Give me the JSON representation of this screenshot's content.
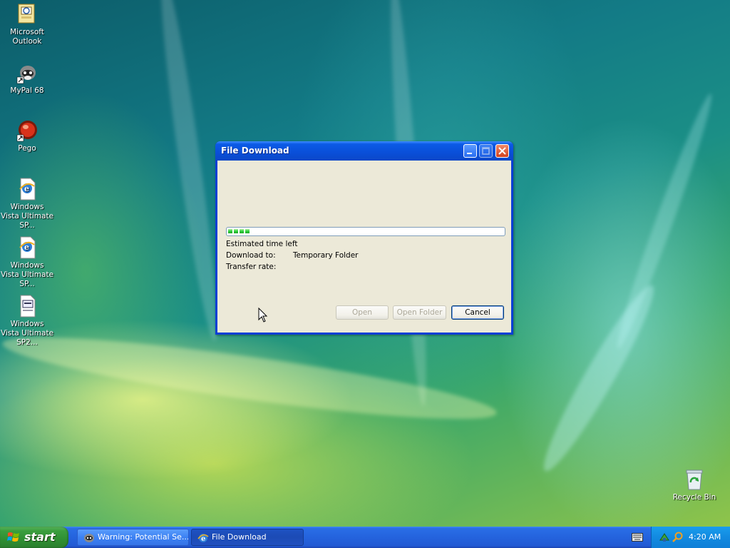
{
  "desktop": {
    "icons": [
      {
        "label": "Microsoft Outlook"
      },
      {
        "label": "MyPal 68"
      },
      {
        "label": "Pego"
      },
      {
        "label": "Windows Vista Ultimate SP..."
      },
      {
        "label": "Windows Vista Ultimate SP..."
      },
      {
        "label": "Windows Vista Ultimate SP2..."
      },
      {
        "label": "Recycle Bin"
      }
    ]
  },
  "dialog": {
    "title": "File Download",
    "progress_percent": 9,
    "estimated_time_label": "Estimated time left",
    "download_to_label": "Download to:",
    "download_to_value": "Temporary Folder",
    "transfer_rate_label": "Transfer rate:",
    "buttons": {
      "open": "Open",
      "open_folder": "Open Folder",
      "cancel": "Cancel"
    }
  },
  "taskbar": {
    "start_label": "start",
    "tasks": [
      {
        "label": "Warning: Potential Se..."
      },
      {
        "label": "File Download"
      }
    ],
    "clock": "4:20 AM"
  },
  "colors": {
    "titlebar": "#0a4fd8",
    "dialog_face": "#ece9d8",
    "progress_fill": "#2cd03a",
    "taskbar": "#2463dd",
    "start_button": "#3b9e3e",
    "tray": "#128ae0"
  }
}
